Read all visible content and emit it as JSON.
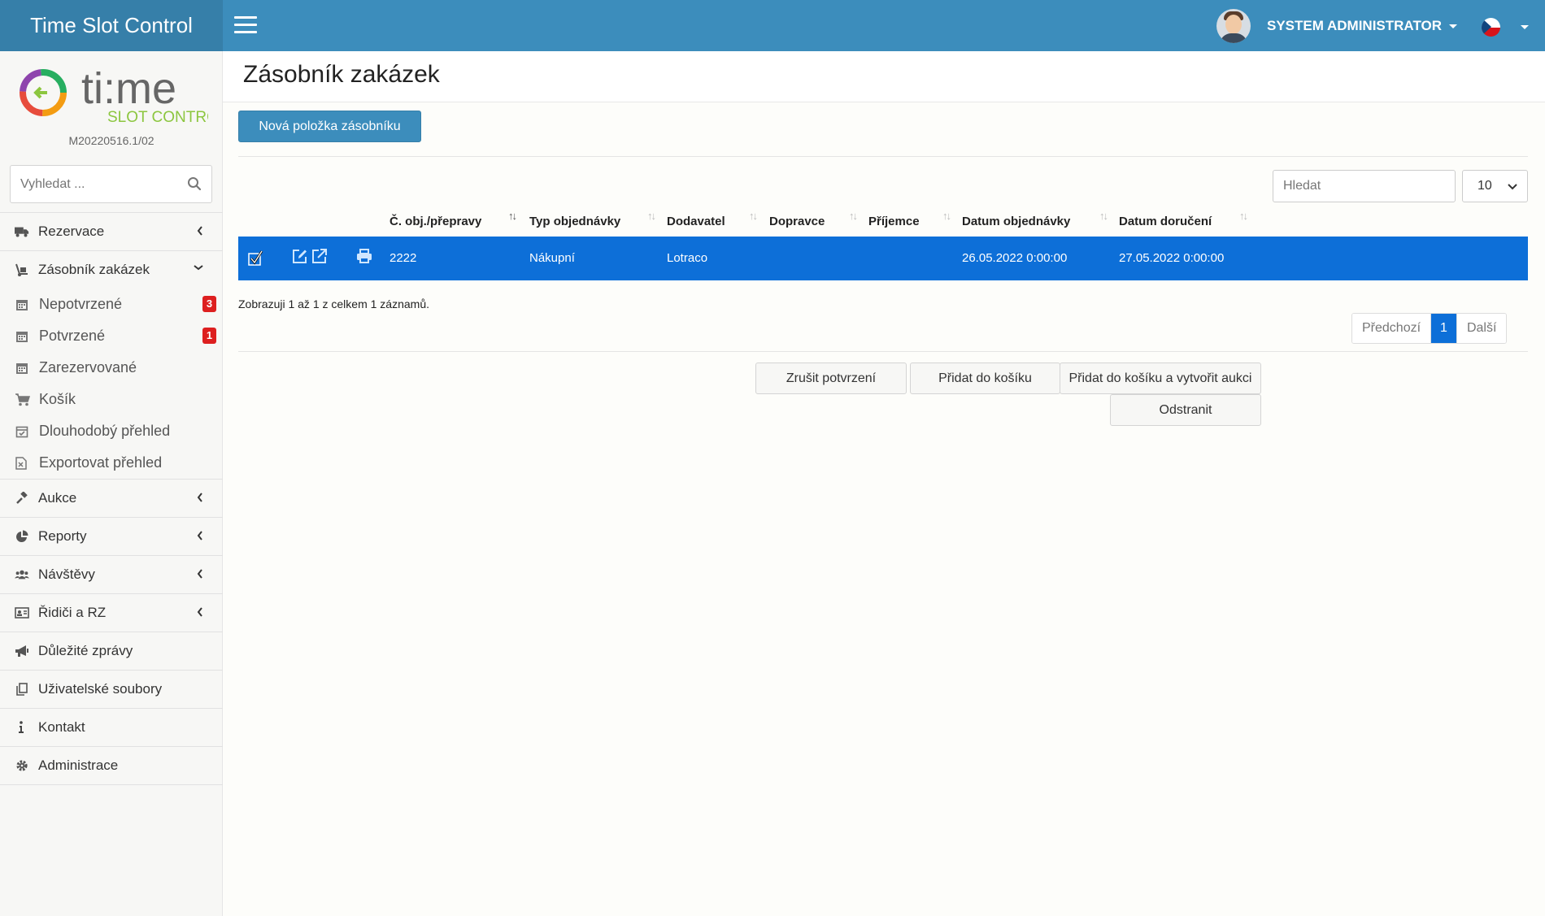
{
  "app": {
    "title": "Time Slot Control",
    "user_name": "SYSTEM ADMINISTRATOR",
    "language_flag": "czech-flag-icon"
  },
  "sidebar": {
    "logo_text": "ti:me",
    "logo_sub": "SLOT CONTROL",
    "version": "M20220516.1/02",
    "search_placeholder": "Vyhledat ...",
    "menu": [
      {
        "label": "Rezervace",
        "icon": "truck-icon"
      },
      {
        "label": "Zásobník zakázek",
        "icon": "dolly-icon",
        "expanded": true
      },
      {
        "label": "Aukce",
        "icon": "gavel-icon"
      },
      {
        "label": "Reporty",
        "icon": "pie-chart-icon"
      },
      {
        "label": "Návštěvy",
        "icon": "users-icon"
      },
      {
        "label": "Řidiči a RZ",
        "icon": "id-card-icon"
      },
      {
        "label": "Důležité zprávy",
        "icon": "megaphone-icon"
      },
      {
        "label": "Uživatelské soubory",
        "icon": "files-icon"
      },
      {
        "label": "Kontakt",
        "icon": "info-icon"
      },
      {
        "label": "Administrace",
        "icon": "gear-icon"
      }
    ],
    "submenu": [
      {
        "label": "Nepotvrzené",
        "icon": "calendar-icon",
        "badge": "3"
      },
      {
        "label": "Potvrzené",
        "icon": "calendar-icon",
        "badge": "1"
      },
      {
        "label": "Zarezervované",
        "icon": "calendar-icon"
      },
      {
        "label": "Košík",
        "icon": "cart-icon"
      },
      {
        "label": "Dlouhodobý přehled",
        "icon": "calendar-check-icon"
      },
      {
        "label": "Exportovat přehled",
        "icon": "excel-file-icon"
      }
    ]
  },
  "main": {
    "title": "Zásobník zakázek",
    "new_button": "Nová položka zásobníku",
    "table_search_placeholder": "Hledat",
    "page_size": "10",
    "columns": [
      "Č. obj./přepravy",
      "Typ objednávky",
      "Dodavatel",
      "Dopravce",
      "Příjemce",
      "Datum objednávky",
      "Datum doručení"
    ],
    "rows": [
      {
        "order_no": "2222",
        "type": "Nákupní",
        "supplier": "Lotraco",
        "carrier": "",
        "recipient": "",
        "order_date": "26.05.2022 0:00:00",
        "delivery_date": "27.05.2022 0:00:00",
        "selected": true
      }
    ],
    "info_text": "Zobrazuji 1 až 1 z celkem 1 záznamů.",
    "pagination": {
      "prev": "Předchozí",
      "current": "1",
      "next": "Další"
    },
    "actions": {
      "cancel_confirm": "Zrušit potvrzení",
      "add_to_cart": "Přidat do košíku",
      "add_to_cart_auction": "Přidat do košíku a vytvořit aukci",
      "remove": "Odstranit"
    }
  },
  "colors": {
    "topbar": "#3c8dbc",
    "brand": "#367fa9",
    "selected_row": "#0d6fd8",
    "badge": "#dd1f1f"
  }
}
